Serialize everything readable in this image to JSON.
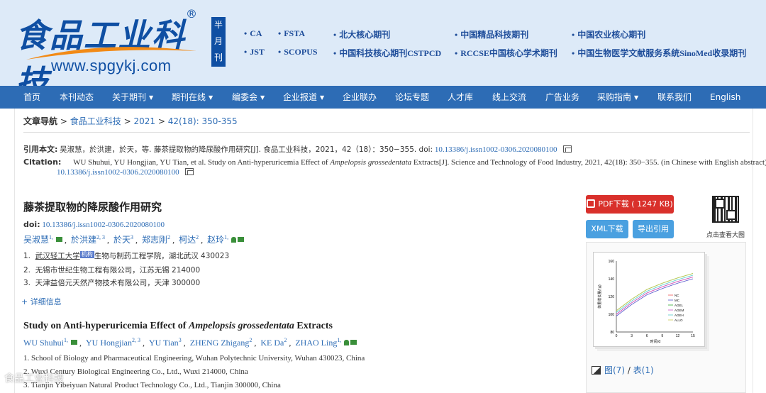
{
  "header": {
    "logo_text": "食品工业科技",
    "logo_reg": "®",
    "logo_url": "www.spgykj.com",
    "frequency": [
      "半",
      "月",
      "刊"
    ],
    "indexes": [
      "CA",
      "FSTA",
      "北大核心期刊",
      "中国精品科技期刊",
      "中国农业核心期刊",
      "JST",
      "SCOPUS",
      "中国科技核心期刊CSTPCD",
      "RCCSE中国核心学术期刊",
      "中国生物医学文献服务系统SinoMed收录期刊"
    ]
  },
  "nav": {
    "items": [
      {
        "label": "首页",
        "dropdown": false
      },
      {
        "label": "本刊动态",
        "dropdown": false
      },
      {
        "label": "关于期刊",
        "dropdown": true
      },
      {
        "label": "期刊在线",
        "dropdown": true
      },
      {
        "label": "编委会",
        "dropdown": true
      },
      {
        "label": "企业报道",
        "dropdown": true
      },
      {
        "label": "企业联办",
        "dropdown": false
      },
      {
        "label": "论坛专题",
        "dropdown": false
      },
      {
        "label": "人才库",
        "dropdown": false
      },
      {
        "label": "线上交流",
        "dropdown": false
      },
      {
        "label": "广告业务",
        "dropdown": false
      },
      {
        "label": "采购指南",
        "dropdown": true
      },
      {
        "label": "联系我们",
        "dropdown": false
      },
      {
        "label": "English",
        "dropdown": false
      }
    ]
  },
  "breadcrumb": {
    "label": "文章导航",
    "sep": ">",
    "items": [
      "食品工业科技",
      "2021",
      "42(18): 350-355"
    ]
  },
  "citation": {
    "cn_label": "引用本文:",
    "cn_text": "吴淑慧，於洪建，於天，等. 藤茶提取物的降尿酸作用研究[J]. 食品工业科技，2021，42（18）：350−355. doi:",
    "doi": "10.13386/j.issn1002-0306.2020080100",
    "en_label": "Citation:",
    "en_text_before": "WU Shuhui, YU Hongjian, YU Tian, et al. Study on Anti-hyperuricemia Effect of",
    "en_species": "Ampelopsis grossedentata",
    "en_text_after": "Extracts[J]. Science and Technology of Food Industry, 2021, 42(18): 350−355. (in Chinese with English abstract). doi:"
  },
  "article": {
    "title_cn": "藤茶提取物的降尿酸作用研究",
    "doi_label": "doi:",
    "doi": "10.13386/j.issn1002-0306.2020080100",
    "authors_cn": [
      {
        "name": "吴淑慧",
        "sup": "1, ",
        "mail": true,
        "person": false
      },
      {
        "name": "於洪建",
        "sup": "2, 3",
        "mail": false,
        "person": false
      },
      {
        "name": "於天",
        "sup": "3",
        "mail": false,
        "person": false
      },
      {
        "name": "郑志刚",
        "sup": "2",
        "mail": false,
        "person": false
      },
      {
        "name": "柯达",
        "sup": "2",
        "mail": false,
        "person": false
      },
      {
        "name": "赵玲",
        "sup": "1, ",
        "mail": true,
        "person": true
      }
    ],
    "affiliations_cn": [
      {
        "num": "1.",
        "link": "武汉轻工大学",
        "badge": "机构",
        "rest": "生物与制药工程学院，湖北武汉 430023"
      },
      {
        "num": "2.",
        "link": "",
        "badge": "",
        "rest": "无锡市世纪生物工程有限公司，江苏无锡 214000"
      },
      {
        "num": "3.",
        "link": "",
        "badge": "",
        "rest": "天津益倍元天然产物技术有限公司，天津 300000"
      }
    ],
    "more_label": "+ 详细信息",
    "title_en_before": "Study on Anti-hyperuricemia Effect of",
    "title_en_species": "Ampelopsis grossedentata",
    "title_en_after": "Extracts",
    "authors_en": [
      {
        "name": "WU Shuhui",
        "sup": "1, ",
        "mail": true,
        "person": false
      },
      {
        "name": "YU Hongjian",
        "sup": "2, 3",
        "mail": false,
        "person": false
      },
      {
        "name": "YU Tian",
        "sup": "3",
        "mail": false,
        "person": false
      },
      {
        "name": "ZHENG Zhigang",
        "sup": "2",
        "mail": false,
        "person": false
      },
      {
        "name": "KE Da",
        "sup": "2",
        "mail": false,
        "person": false
      },
      {
        "name": "ZHAO Ling",
        "sup": "1, ",
        "mail": true,
        "person": true
      }
    ],
    "affiliations_en": [
      "1.  School of Biology and Pharmaceutical Engineering, Wuhan Polytechnic University, Wuhan 430023, China",
      "2.  Wuxi Century Biological Engineering Co., Ltd., Wuxi 214000, China",
      "3.  Tianjin Yibeiyuan Natural Product Technology Co., Ltd., Tianjin 300000, China"
    ]
  },
  "sidebar": {
    "pdf_label": "PDF下载 ( 1247 KB)",
    "xml_label": "XML下载",
    "cite_label": "导出引用",
    "qr_label": "点击查看大图",
    "figure_label_a": "图(7)",
    "figure_sep": " / ",
    "figure_label_b": "表(1)",
    "thumbnail": {
      "yticks": [
        "160",
        "140",
        "120",
        "100",
        "80"
      ],
      "xticks": [
        "0",
        "3",
        "6",
        "9",
        "12",
        "15"
      ],
      "ylabel": "体重增长量/(g)",
      "xlabel": "时间/d",
      "legend": [
        "NC",
        "MC",
        "AGEL",
        "AGEM",
        "AGEH",
        "ALLO"
      ],
      "colors": [
        "#e55",
        "#55c",
        "#3a3",
        "#c5c",
        "#5cc",
        "#cc5"
      ]
    }
  },
  "watermark": "食品工业科技"
}
